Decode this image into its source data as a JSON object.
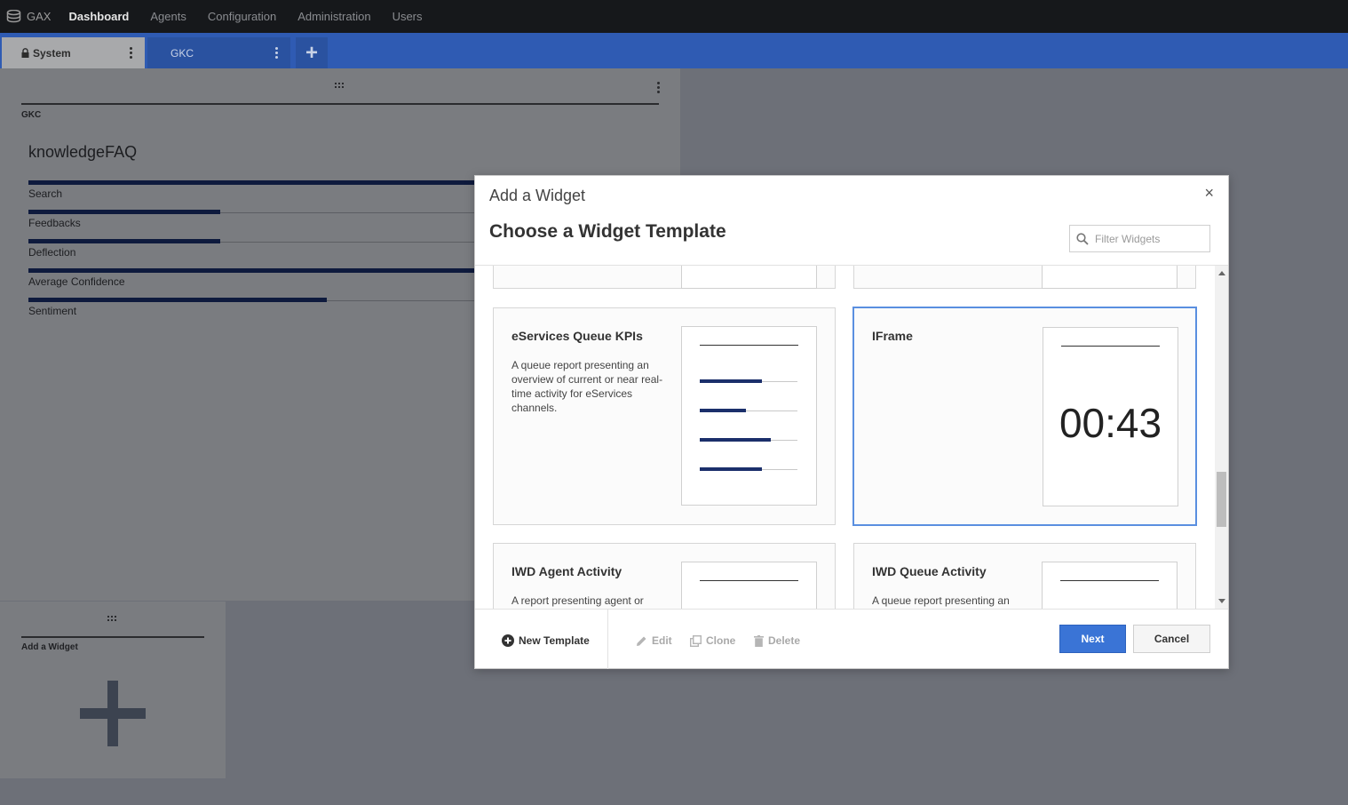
{
  "nav": {
    "brand": "GAX",
    "items": [
      "Dashboard",
      "Agents",
      "Configuration",
      "Administration",
      "Users"
    ]
  },
  "tabs": [
    {
      "label": "System",
      "locked": true
    },
    {
      "label": "GKC",
      "locked": false
    }
  ],
  "add_tab_label": "+",
  "dashboard_widget": {
    "category": "GKC",
    "title": "knowledgeFAQ",
    "kpis": [
      {
        "label": "Search",
        "fill": 1.0
      },
      {
        "label": "Feedbacks",
        "fill": 0.43
      },
      {
        "label": "Deflection",
        "fill": 0.43
      },
      {
        "label": "Average Confidence",
        "fill": 1.0
      },
      {
        "label": "Sentiment",
        "fill": 0.67
      }
    ]
  },
  "add_widget_tile": {
    "label": "Add a Widget"
  },
  "modal": {
    "title": "Add a Widget",
    "subtitle": "Choose a Widget Template",
    "close_label": "×",
    "filter_placeholder": "Filter Widgets",
    "cards": [
      {
        "title": "eServices Queue KPIs",
        "description": "A queue report presenting an overview of current or near real-time activity for eServices channels.",
        "preview_bars": [
          0.64,
          0.47,
          0.73,
          0.64
        ]
      },
      {
        "title": "IFrame",
        "description": "",
        "preview_time": "00:43",
        "selected": true
      },
      {
        "title": "IWD Agent Activity",
        "description": "A report presenting agent or"
      },
      {
        "title": "IWD Queue Activity",
        "description": "A queue report presenting an"
      }
    ],
    "footer": {
      "new_template": "New Template",
      "edit": "Edit",
      "clone": "Clone",
      "delete": "Delete",
      "next": "Next",
      "cancel": "Cancel"
    }
  },
  "colors": {
    "accent": "#3a74d6",
    "tabbar": "#2f5bb3",
    "topnav": "#16181b",
    "selected_border": "#5a8fe0"
  }
}
